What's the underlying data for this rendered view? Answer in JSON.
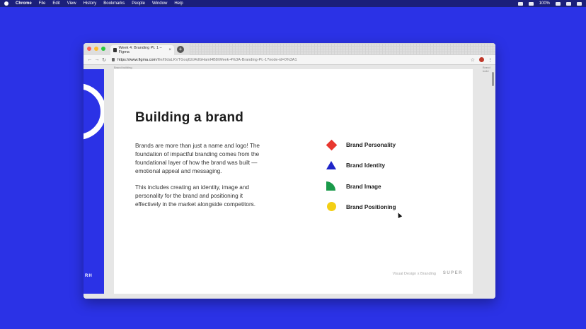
{
  "menubar": {
    "app": "Chrome",
    "items": [
      "File",
      "Edit",
      "View",
      "History",
      "Bookmarks",
      "People",
      "Window",
      "Help"
    ],
    "battery": "100%"
  },
  "browser": {
    "tab_title": "Week 4: Branding Pt. 1 – Figma",
    "tab_close": "×",
    "new_tab": "+",
    "url_host": "https://www.figma.com",
    "url_path": "/file/l9daLKVTGoq62d4dGHaml4B8/Week-4%3A-Branding-Pt.-1?node-id=0%3A1",
    "back": "←",
    "forward": "→",
    "reload": "↻",
    "star": "☆",
    "menu": "⋮"
  },
  "canvas": {
    "frame_label_left": "Brand building",
    "frame_label_right": "Brand build"
  },
  "slide": {
    "title": "Building a brand",
    "paragraph1": "Brands are more than just a name and logo! The foundation of impactful branding comes from the foundational layer of how the brand was built — emotional appeal and messaging.",
    "paragraph2": "This includes creating an identity, image and personality for the brand and positioning it effectively in the market alongside competitors.",
    "pillars": [
      {
        "label": "Brand Personality",
        "shape": "red-diamond",
        "color": "#e8372f"
      },
      {
        "label": "Brand Identity",
        "shape": "blue-triangle",
        "color": "#1e25c8"
      },
      {
        "label": "Brand Image",
        "shape": "green-quarter-circle",
        "color": "#1a9a4a"
      },
      {
        "label": "Brand Positioning",
        "shape": "yellow-circle",
        "color": "#f3cf14"
      }
    ],
    "footer_text": "Visual Design x Branding",
    "footer_mark": "SUPER"
  },
  "left_panel": {
    "brandmark": "RH"
  },
  "colors": {
    "background": "#2b32e6"
  }
}
